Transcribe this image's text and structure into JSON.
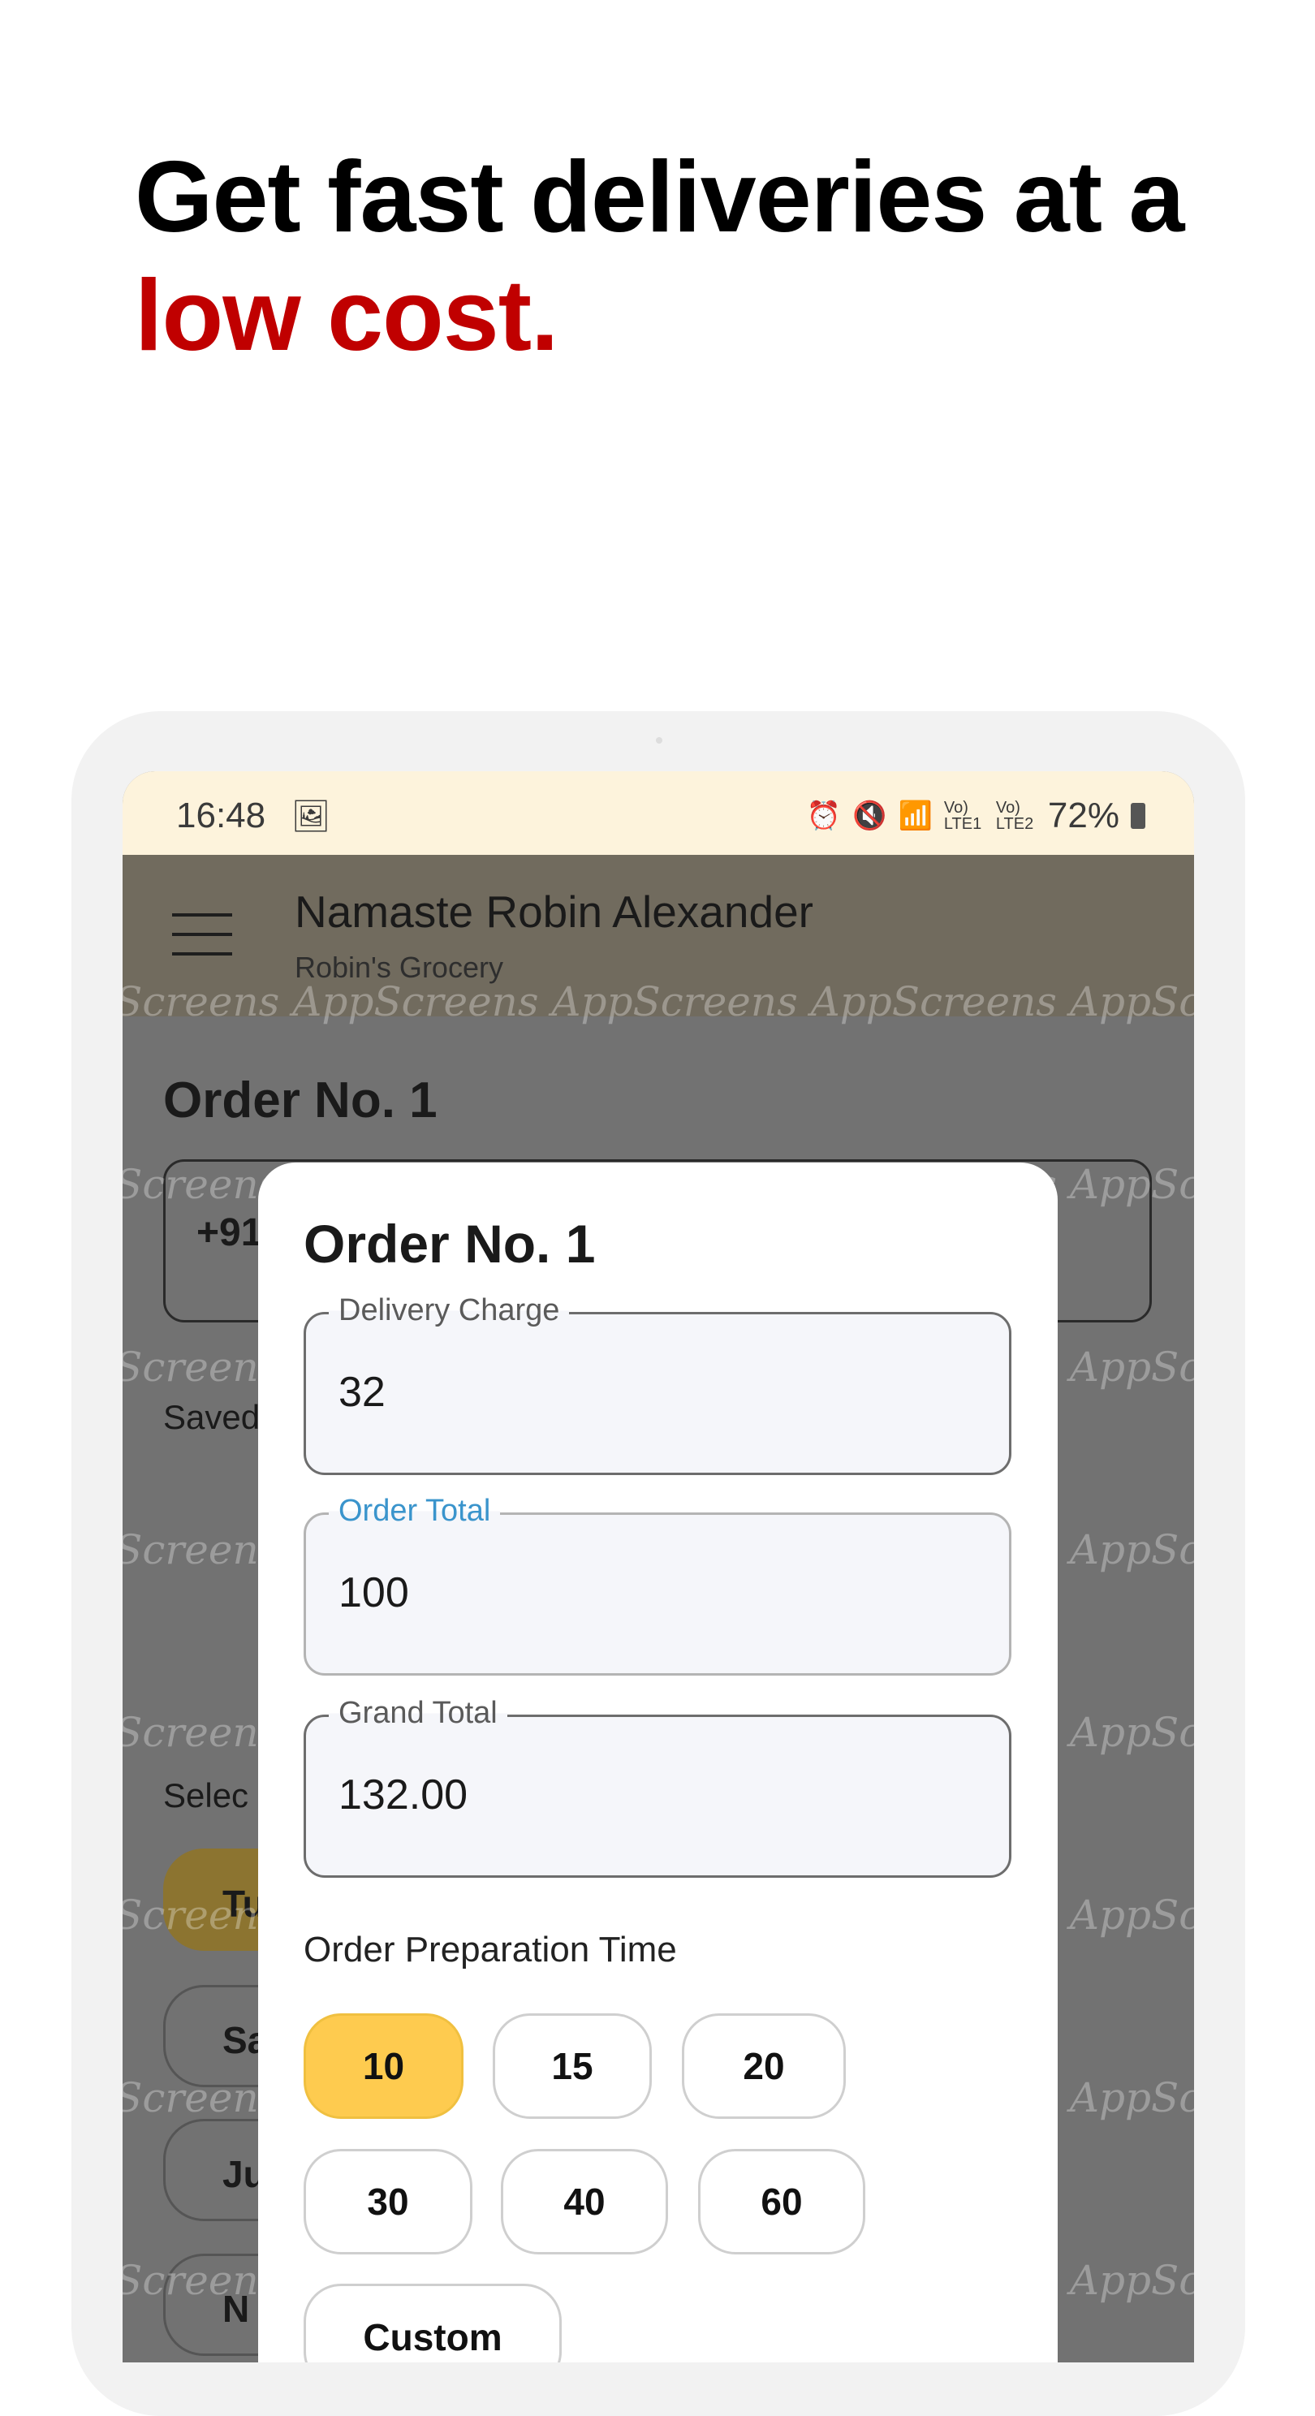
{
  "headline": {
    "line1": "Get fast deliveries at a",
    "line2": "low cost."
  },
  "colors": {
    "accent_red": "#c00000",
    "selected_chip": "#fecb4f",
    "focus_label": "#3a94cc",
    "appbar": "#716b5e",
    "status_bar": "#fdf3dc"
  },
  "status_bar": {
    "time": "16:48",
    "battery": "72%",
    "icons": [
      "gallery-icon",
      "alarm-icon",
      "mute-icon",
      "wifi-icon",
      "lte1-signal-icon",
      "lte2-signal-icon",
      "battery-icon"
    ],
    "lte1": "Vo) LTE1",
    "lte2": "Vo) LTE2"
  },
  "app_bar": {
    "title": "Namaste Robin Alexander",
    "subtitle": "Robin's Grocery",
    "menu_icon": "hamburger-icon"
  },
  "background": {
    "title": "Order No. 1",
    "phone_prefix": "+91",
    "saved_label": "Saved",
    "select_label": "Selec",
    "chips": [
      "Tu",
      "Sa",
      "Ju",
      "N"
    ]
  },
  "watermark": "AppScreens",
  "dialog": {
    "title": "Order No. 1",
    "fields": [
      {
        "label": "Delivery Charge",
        "value": "32"
      },
      {
        "label": "Order Total",
        "value": "100",
        "focused": true
      },
      {
        "label": "Grand Total",
        "value": "132.00"
      }
    ],
    "prep_label": "Order Preparation Time",
    "prep_options": [
      "10",
      "15",
      "20",
      "30",
      "40",
      "60",
      "Custom"
    ],
    "selected_prep": "10"
  }
}
